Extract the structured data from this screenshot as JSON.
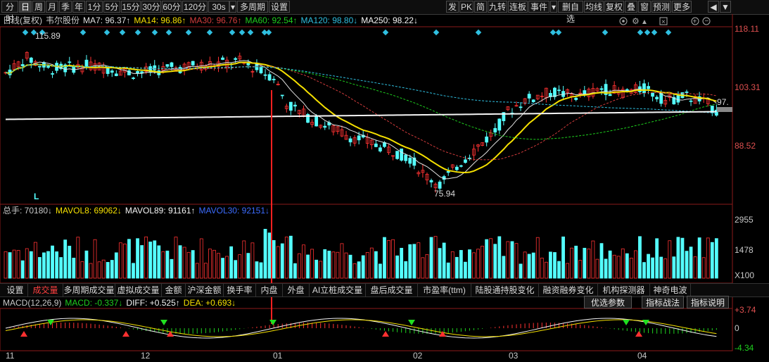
{
  "toolbar": {
    "left_buttons": [
      "分时",
      "日",
      "周",
      "月",
      "季",
      "年",
      "1分",
      "5分",
      "15分",
      "30分",
      "60分",
      "120分",
      "30s",
      "多周期",
      "设置"
    ],
    "active": "日",
    "right_buttons": [
      "发",
      "PK",
      "简",
      "九转",
      "连板",
      "事件",
      "删自选",
      "均线",
      "复权",
      "叠",
      "窗",
      "预测",
      "更多"
    ]
  },
  "legend": {
    "price": [
      {
        "text": "日线(复权)",
        "color": "#c8c8c8"
      },
      {
        "text": "韦尔股份",
        "color": "#c8c8c8"
      },
      {
        "text": "MA7: 96.37↑",
        "color": "#e0e0e0"
      },
      {
        "text": "MA14: 96.86↑",
        "color": "#f5e000"
      },
      {
        "text": "MA30: 96.76↑",
        "color": "#d23c3c"
      },
      {
        "text": "MA60: 92.54↑",
        "color": "#1ecf1e"
      },
      {
        "text": "MA120: 98.80↓",
        "color": "#2fbfe0"
      },
      {
        "text": "MA250: 98.22↓",
        "color": "#f5f5f5"
      }
    ],
    "volume": [
      {
        "text": "总手: 70180↓",
        "color": "#c8c8c8"
      },
      {
        "text": "MAVOL8: 69062↓",
        "color": "#f5e000"
      },
      {
        "text": "MAVOL89: 91161↑",
        "color": "#f5f5f5"
      },
      {
        "text": "MAVOL30: 92151↓",
        "color": "#3c6cff"
      }
    ],
    "macd": [
      {
        "text": "MACD(12,26,9)",
        "color": "#c8c8c8"
      },
      {
        "text": "MACD: -0.337↓",
        "color": "#1ecf1e"
      },
      {
        "text": "DIFF: +0.525↑",
        "color": "#f5f5f5"
      },
      {
        "text": "DEA: +0.693↓",
        "color": "#f5e000"
      }
    ]
  },
  "price_axis": [
    "118.11",
    "103.31",
    "88.52"
  ],
  "price_marks": {
    "high": "115.89",
    "low": "75.94",
    "last": "97."
  },
  "vol_axis": [
    "2955",
    "1478",
    "X100"
  ],
  "macd_axis": [
    "+3.74",
    "0",
    "-4.34"
  ],
  "x_labels": [
    "11",
    "12",
    "01",
    "02",
    "03",
    "04"
  ],
  "tabs": [
    "设置",
    "成交量",
    "多周期成交量",
    "虚拟成交量",
    "金额",
    "沪深金额",
    "换手率",
    "内盘",
    "外盘",
    "AI立桩成交量",
    "盘后成交量",
    "市盈率(ttm)",
    "陆股通持股变化",
    "融资融券变化",
    "机构探测器",
    "神奇电波"
  ],
  "active_tab": "成交量",
  "panel_buttons": [
    "优选参数",
    "指标战法",
    "指标说明"
  ],
  "marker_L": "L",
  "colors": {
    "up": "#ff3232",
    "down": "#54ffff",
    "ma7": "#e0e0e0",
    "ma14": "#f5e000",
    "ma30": "#d23c3c",
    "ma60": "#1ecf1e",
    "ma120": "#2fbfe0",
    "ma250": "#f5f5f5",
    "cursor": "#ff2020"
  }
}
